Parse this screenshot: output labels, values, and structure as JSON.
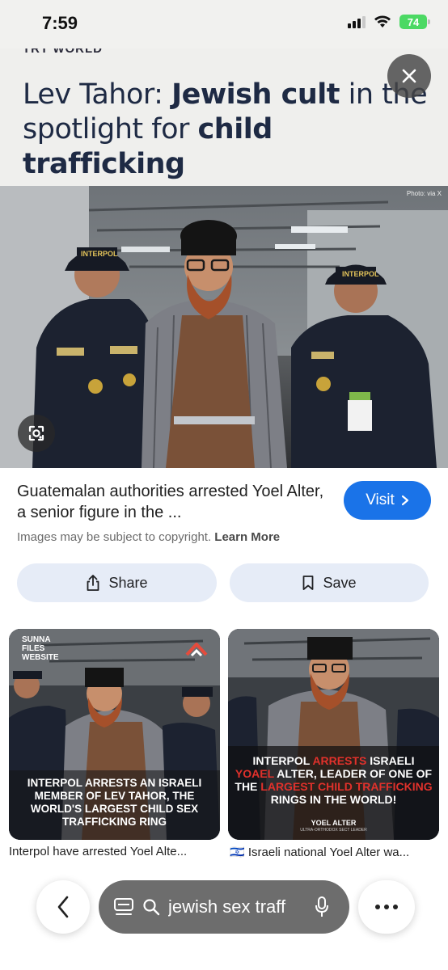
{
  "status_bar": {
    "time": "7:59",
    "battery": "74"
  },
  "article": {
    "site_name": "TRT WORLD",
    "headline_plain_1": "Lev Tahor: ",
    "headline_bold_1": "Jewish cult",
    "headline_plain_2": " in the spotlight for ",
    "headline_bold_2": "child trafficking",
    "photo_credit": "Photo: via X"
  },
  "hero_image": {
    "badge_left": "INTERPOL",
    "badge_right": "INTERPOL"
  },
  "result": {
    "caption": "Guatemalan authorities arrested Yoel Alter, a senior figure in the ...",
    "visit_label": "Visit",
    "copyright_text": "Images may be subject to copyright.",
    "learn_more": "Learn More",
    "share_label": "Share",
    "save_label": "Save"
  },
  "related": [
    {
      "source_badge": "SUNNA FILES WEBSITE",
      "overlay_text": "INTERPOL ARRESTS AN ISRAELI MEMBER OF LEV TAHOR, THE WORLD'S LARGEST CHILD SEX TRAFFICKING RING",
      "title": "Interpol have arrested Yoel Alte..."
    },
    {
      "overlay_a": "INTERPOL ",
      "overlay_b": "ARRESTS",
      "overlay_c": " ISRAELI ",
      "overlay_d": "YOAEL",
      "overlay_e": " ALTER, LEADER OF ONE OF THE ",
      "overlay_f": "LARGEST CHILD TRAFFICKING",
      "overlay_g": " RINGS IN THE WORLD!",
      "overlay_name": "YOEL ALTER",
      "overlay_sub": "ULTRA-ORTHODOX SECT LEADER",
      "flag": "🇮🇱",
      "title": "Israeli national Yoel Alter wa..."
    }
  ],
  "search": {
    "query": "jewish sex traff"
  },
  "colors": {
    "visit": "#1a73e8",
    "action_bg": "#e6ecf7",
    "headline": "#1e2a44"
  }
}
